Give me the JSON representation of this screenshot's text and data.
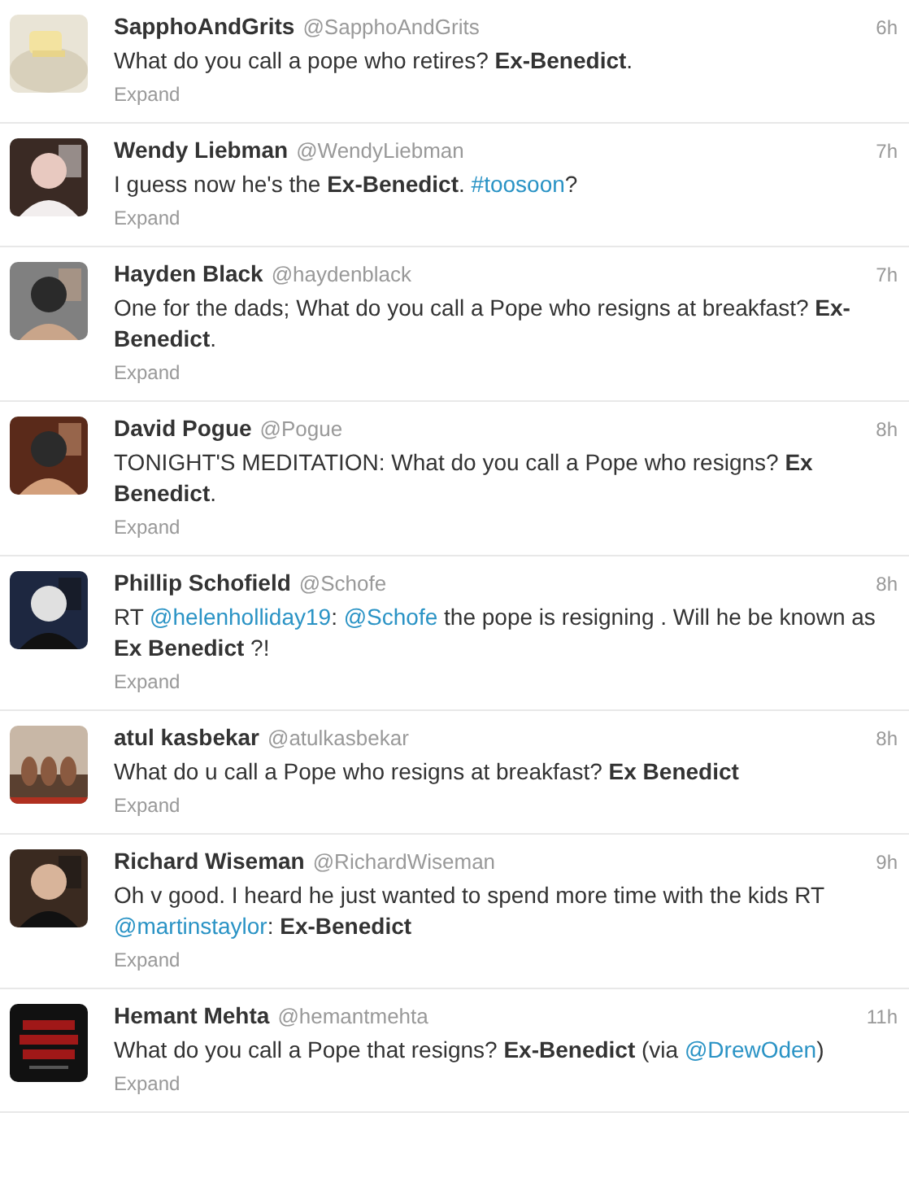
{
  "tweets": [
    {
      "name": "SapphoAndGrits",
      "handle": "@SapphoAndGrits",
      "time": "6h",
      "body": [
        {
          "kind": "text",
          "text": "What do you call a pope who retires? **Ex-Benedict**."
        }
      ],
      "expand": "Expand"
    },
    {
      "name": "Wendy Liebman",
      "handle": "@WendyLiebman",
      "time": "7h",
      "body": [
        {
          "kind": "text",
          "text": "I guess now he's the **Ex-Benedict**. "
        },
        {
          "kind": "link",
          "text": "#toosoon"
        },
        {
          "kind": "text",
          "text": "?"
        }
      ],
      "expand": "Expand"
    },
    {
      "name": "Hayden Black",
      "handle": "@haydenblack",
      "time": "7h",
      "body": [
        {
          "kind": "text",
          "text": "One for the dads; What do you call a Pope who resigns at breakfast? **Ex-Benedict**."
        }
      ],
      "expand": "Expand"
    },
    {
      "name": "David Pogue",
      "handle": "@Pogue",
      "time": "8h",
      "body": [
        {
          "kind": "text",
          "text": "TONIGHT'S MEDITATION: What do you call a Pope who resigns? **Ex Benedict**."
        }
      ],
      "expand": "Expand"
    },
    {
      "name": "Phillip Schofield",
      "handle": "@Schofe",
      "time": "8h",
      "body": [
        {
          "kind": "text",
          "text": "RT "
        },
        {
          "kind": "link",
          "text": "@helenholliday19"
        },
        {
          "kind": "text",
          "text": ": "
        },
        {
          "kind": "link",
          "text": "@Schofe"
        },
        {
          "kind": "text",
          "text": " the pope is resigning . Will he be known as **Ex Benedict** ?!"
        }
      ],
      "expand": "Expand"
    },
    {
      "name": "atul kasbekar",
      "handle": "@atulkasbekar",
      "time": "8h",
      "body": [
        {
          "kind": "text",
          "text": "What do u call a Pope who resigns at breakfast? **Ex Benedict**"
        }
      ],
      "expand": "Expand"
    },
    {
      "name": "Richard Wiseman",
      "handle": "@RichardWiseman",
      "time": "9h",
      "body": [
        {
          "kind": "text",
          "text": "Oh v good. I heard he just wanted to spend more time with the kids RT "
        },
        {
          "kind": "link",
          "text": "@martinstaylor"
        },
        {
          "kind": "text",
          "text": ": **Ex-Benedict**"
        }
      ],
      "expand": "Expand"
    },
    {
      "name": "Hemant Mehta",
      "handle": "@hemantmehta",
      "time": "11h",
      "body": [
        {
          "kind": "text",
          "text": "What do you call a Pope that resigns? **Ex-Benedict** (via "
        },
        {
          "kind": "link",
          "text": "@DrewOden"
        },
        {
          "kind": "text",
          "text": ")"
        }
      ],
      "expand": "Expand"
    }
  ]
}
